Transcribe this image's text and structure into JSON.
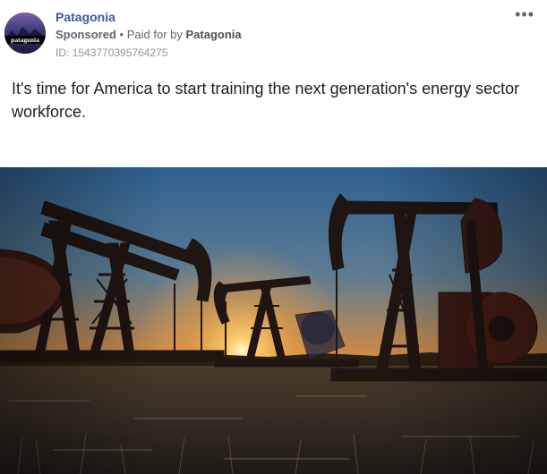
{
  "post": {
    "page_name": "Patagonia",
    "avatar_text": "patagonia",
    "sponsored_label": "Sponsored",
    "separator": "•",
    "paid_prefix": "Paid for by",
    "paid_by": "Patagonia",
    "ad_id": "ID: 1543770395764275",
    "more_label": "•••",
    "text": "It's time for America to start training the next generation's energy sector workforce."
  },
  "media": {
    "description_icon": "oil-pumpjacks-sunset-image"
  }
}
